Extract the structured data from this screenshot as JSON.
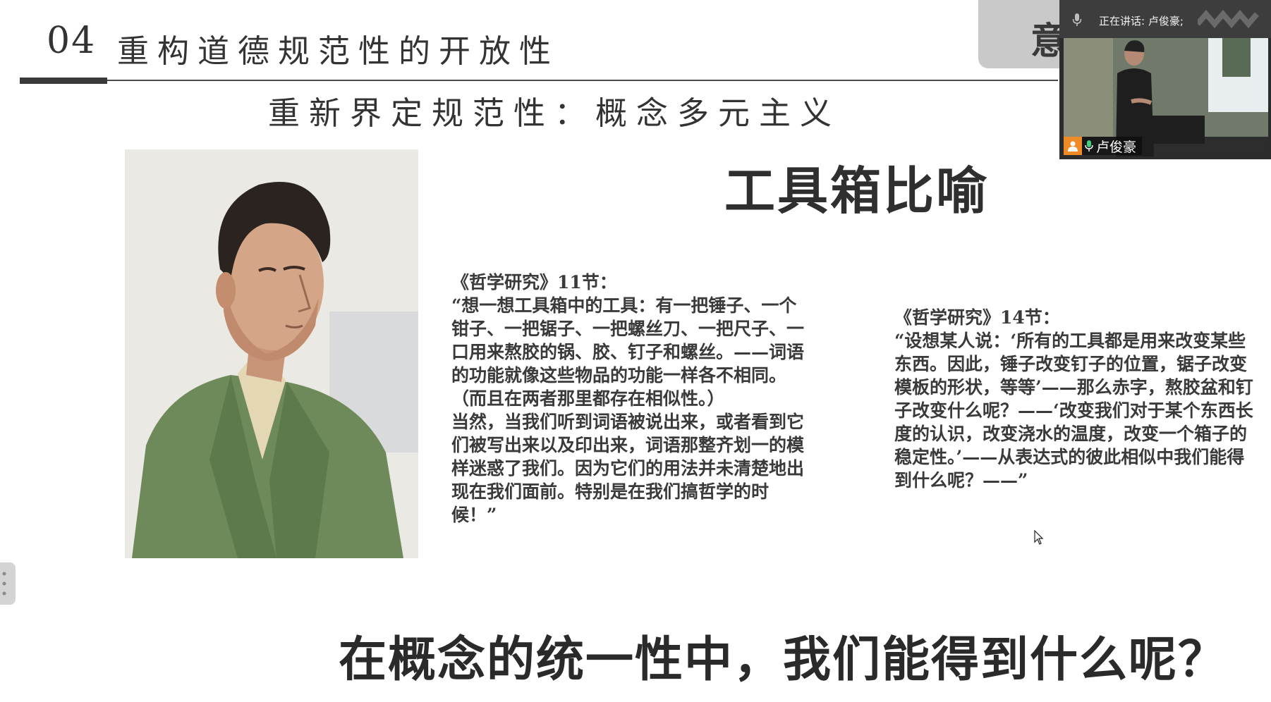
{
  "slide": {
    "section_number": "04",
    "section_title": "重构道德规范性的开放性",
    "subtitle": "重新界定规范性：概念多元主义",
    "grey_tab_text": "意",
    "heading": "工具箱比喻",
    "quote_11": {
      "source": "《哲学研究》11节：",
      "paragraphs": [
        "“想一想工具箱中的工具：有一把锤子、一个钳子、一把锯子、一把螺丝刀、一把尺子、一口用来熬胶的锅、胶、钉子和螺丝。——词语的功能就像这些物品的功能一样各不相同。（而且在两者那里都存在相似性。）",
        "当然，当我们听到词语被说出来，或者看到它们被写出来以及印出来，词语那整齐划一的模样迷惑了我们。因为它们的用法并未清楚地出现在我们面前。特别是在我们搞哲学的时候！”"
      ]
    },
    "quote_14": {
      "source": "《哲学研究》14节：",
      "paragraphs": [
        "“设想某人说：‘所有的工具都是用来改变某些东西。因此，锤子改变钉子的位置，锯子改变模板的形状，等等’——那么赤字，熬胶盆和钉子改变什么呢？——‘改变我们对于某个东西长度的认识，改变浇水的温度，改变一个箱子的稳定性。’——从表达式的彼此相似中我们能得到什么呢？——”"
      ]
    },
    "bottom_question": "在概念的统一性中，我们能得到什么呢？"
  },
  "video": {
    "speaking_label": "正在讲话: 卢俊豪;",
    "speaker_name": "卢俊豪"
  },
  "colors": {
    "accent_orange": "#f08a24",
    "rule": "#3a3a3a",
    "jacket_green": "#6f8a5a"
  },
  "icons": [
    "microphone-icon",
    "user-avatar-icon",
    "mouse-cursor-icon",
    "drag-handle-icon"
  ]
}
